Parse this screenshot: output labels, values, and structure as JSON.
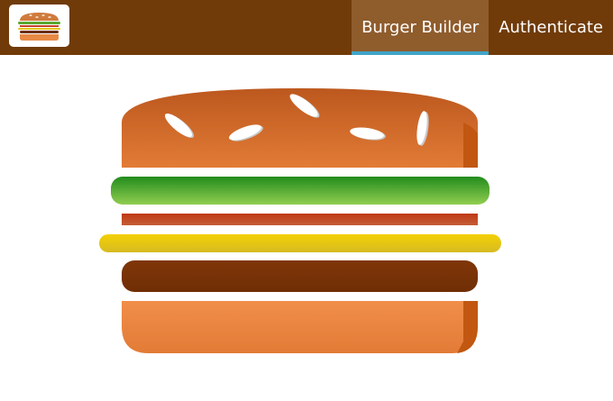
{
  "toolbar": {
    "logo_icon": "burger-logo-icon",
    "nav": [
      {
        "label": "Burger Builder",
        "active": true
      },
      {
        "label": "Authenticate",
        "active": false
      }
    ]
  },
  "burger": {
    "ingredients": [
      "bread-top",
      "salad",
      "bacon",
      "cheese",
      "meat",
      "bread-bottom"
    ]
  },
  "colors": {
    "toolbar_bg": "#703b09",
    "active_tab_bg": "#8f5c2c",
    "active_underline": "#40a4c8"
  }
}
